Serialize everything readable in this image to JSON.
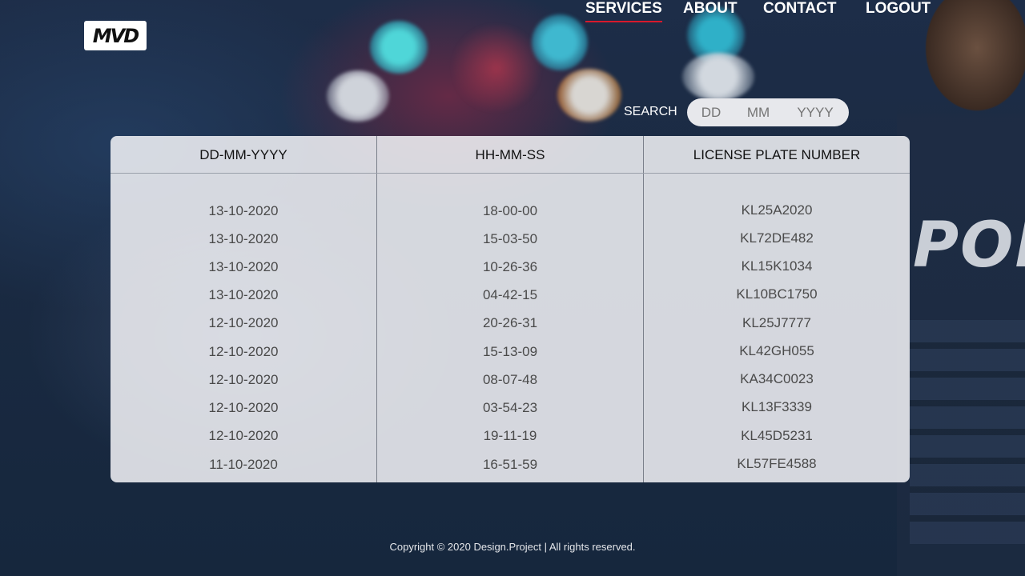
{
  "header": {
    "logo_text": "MVD",
    "nav": [
      {
        "label": "SERVICES",
        "active": true
      },
      {
        "label": "ABOUT",
        "active": false
      },
      {
        "label": "CONTACT",
        "active": false
      },
      {
        "label": "LOGOUT",
        "active": false
      }
    ]
  },
  "search": {
    "label": "SEARCH",
    "dd_placeholder": "DD",
    "mm_placeholder": "MM",
    "yyyy_placeholder": "YYYY"
  },
  "table": {
    "columns": [
      "DD-MM-YYYY",
      "HH-MM-SS",
      "LICENSE PLATE NUMBER"
    ],
    "rows": [
      [
        "13-10-2020",
        "18-00-00",
        "KL25A2020"
      ],
      [
        "13-10-2020",
        "15-03-50",
        "KL72DE482"
      ],
      [
        "13-10-2020",
        "10-26-36",
        "KL15K1034"
      ],
      [
        "13-10-2020",
        "04-42-15",
        "KL10BC1750"
      ],
      [
        "12-10-2020",
        "20-26-31",
        "KL25J7777"
      ],
      [
        "12-10-2020",
        "15-13-09",
        "KL42GH055"
      ],
      [
        "12-10-2020",
        "08-07-48",
        "KA34C0023"
      ],
      [
        "12-10-2020",
        "03-54-23",
        "KL13F3339"
      ],
      [
        "12-10-2020",
        "19-11-19",
        "KL45D5231"
      ],
      [
        "11-10-2020",
        "16-51-59",
        "KL57FE4588"
      ]
    ]
  },
  "background": {
    "badge_text": "POLICE"
  },
  "footer": {
    "copyright": "Copyright © 2020 Design.Project | All rights reserved."
  },
  "colors": {
    "accent": "#d8192b",
    "panel": "#f5f5f8",
    "nav_text": "#ffffff"
  }
}
